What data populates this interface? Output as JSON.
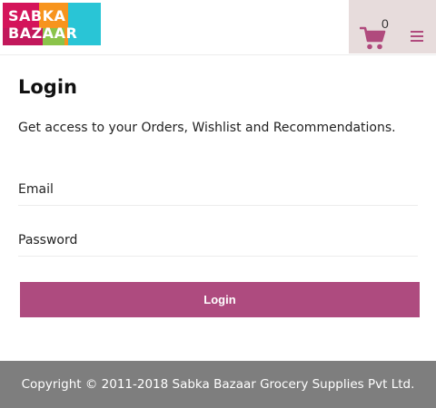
{
  "header": {
    "logo_line1": "SABKA",
    "logo_line2": "BAZAAR",
    "cart_count": "0",
    "icons": {
      "cart": "cart-icon",
      "menu": "menu-icon"
    }
  },
  "login": {
    "title": "Login",
    "subtitle": "Get access to your Orders, Wishlist and Recommendations.",
    "email_placeholder": "Email",
    "password_placeholder": "Password",
    "button_label": "Login"
  },
  "footer": {
    "copyright": "Copyright © 2011-2018 Sabka Bazaar Grocery Supplies Pvt Ltd."
  },
  "colors": {
    "accent": "#ae4b7f",
    "cart_bg": "#e7dcdc",
    "footer_bg": "#7e7e7e"
  }
}
